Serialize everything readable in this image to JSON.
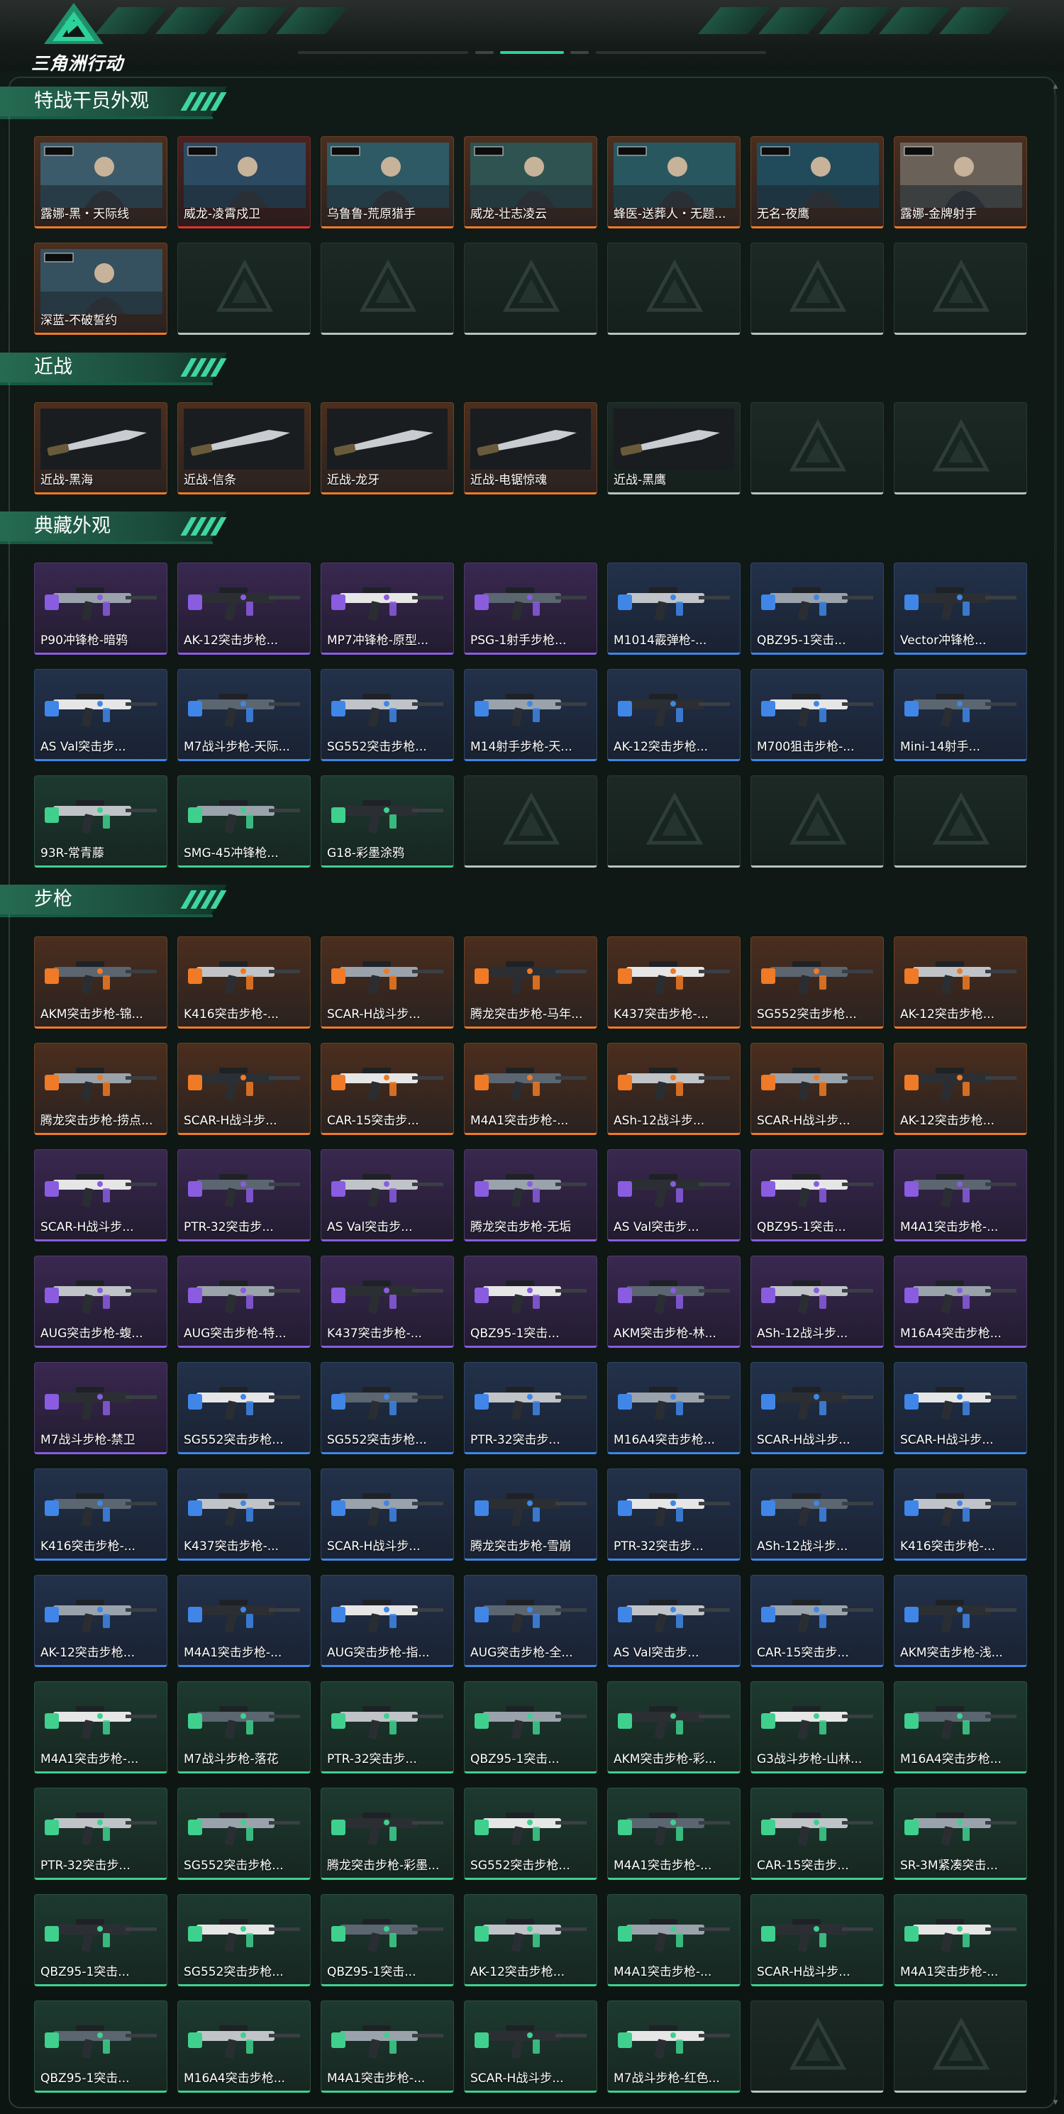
{
  "header": {
    "logo_text": "三角洲行动",
    "logo_icon": "delta-logo-icon",
    "accent": "#2bd29a"
  },
  "colors": {
    "orange": "#f07a25",
    "red": "#e0322c",
    "purple": "#8a5ce0",
    "blue": "#3f86e8",
    "green": "#3fd08e",
    "empty": "#b8c2bf"
  },
  "sections": [
    {
      "title": "特战干员外观",
      "items": [
        {
          "label": "露娜-黑・天际线",
          "rarity": "orange",
          "icon": "operator-portrait"
        },
        {
          "label": "威龙-凌霄戍卫",
          "rarity": "red",
          "icon": "operator-portrait"
        },
        {
          "label": "乌鲁鲁-荒原猎手",
          "rarity": "orange",
          "icon": "operator-portrait"
        },
        {
          "label": "威龙-壮志凌云",
          "rarity": "orange",
          "icon": "operator-portrait"
        },
        {
          "label": "蜂医-送葬人・无题...",
          "rarity": "orange",
          "icon": "operator-portrait"
        },
        {
          "label": "无名-夜鹰",
          "rarity": "orange",
          "icon": "operator-portrait"
        },
        {
          "label": "露娜-金牌射手",
          "rarity": "orange",
          "icon": "operator-portrait"
        },
        {
          "label": "深蓝-不破誓约",
          "rarity": "orange",
          "icon": "operator-portrait"
        },
        {
          "label": "",
          "rarity": "empty",
          "icon": "empty-slot-icon"
        },
        {
          "label": "",
          "rarity": "empty",
          "icon": "empty-slot-icon"
        },
        {
          "label": "",
          "rarity": "empty",
          "icon": "empty-slot-icon"
        },
        {
          "label": "",
          "rarity": "empty",
          "icon": "empty-slot-icon"
        },
        {
          "label": "",
          "rarity": "empty",
          "icon": "empty-slot-icon"
        },
        {
          "label": "",
          "rarity": "empty",
          "icon": "empty-slot-icon"
        }
      ]
    },
    {
      "title": "近战",
      "items": [
        {
          "label": "近战-黑海",
          "rarity": "orange",
          "icon": "melee-weapon"
        },
        {
          "label": "近战-信条",
          "rarity": "orange",
          "icon": "melee-weapon"
        },
        {
          "label": "近战-龙牙",
          "rarity": "orange",
          "icon": "melee-weapon"
        },
        {
          "label": "近战-电锯惊魂",
          "rarity": "orange",
          "icon": "melee-weapon"
        },
        {
          "label": "近战-黑鹰",
          "rarity": "empty",
          "icon": "melee-weapon"
        },
        {
          "label": "",
          "rarity": "empty",
          "icon": "empty-slot-icon"
        },
        {
          "label": "",
          "rarity": "empty",
          "icon": "empty-slot-icon"
        }
      ]
    },
    {
      "title": "典藏外观",
      "items": [
        {
          "label": "P90冲锋枪-暗鸦",
          "rarity": "purple",
          "icon": "gun"
        },
        {
          "label": "AK-12突击步枪...",
          "rarity": "purple",
          "icon": "gun"
        },
        {
          "label": "MP7冲锋枪-原型...",
          "rarity": "purple",
          "icon": "gun"
        },
        {
          "label": "PSG-1射手步枪...",
          "rarity": "purple",
          "icon": "gun"
        },
        {
          "label": "M1014霰弹枪-...",
          "rarity": "blue",
          "icon": "gun"
        },
        {
          "label": "QBZ95-1突击...",
          "rarity": "blue",
          "icon": "gun"
        },
        {
          "label": "Vector冲锋枪...",
          "rarity": "blue",
          "icon": "gun"
        },
        {
          "label": "AS Val突击步...",
          "rarity": "blue",
          "icon": "gun"
        },
        {
          "label": "M7战斗步枪-天际...",
          "rarity": "blue",
          "icon": "gun"
        },
        {
          "label": "SG552突击步枪...",
          "rarity": "blue",
          "icon": "gun"
        },
        {
          "label": "M14射手步枪-天...",
          "rarity": "blue",
          "icon": "gun"
        },
        {
          "label": "AK-12突击步枪...",
          "rarity": "blue",
          "icon": "gun"
        },
        {
          "label": "M700狙击步枪-...",
          "rarity": "blue",
          "icon": "gun"
        },
        {
          "label": "Mini-14射手...",
          "rarity": "blue",
          "icon": "gun"
        },
        {
          "label": "93R-常青藤",
          "rarity": "green",
          "icon": "gun"
        },
        {
          "label": "SMG-45冲锋枪...",
          "rarity": "green",
          "icon": "gun"
        },
        {
          "label": "G18-彩墨涂鸦",
          "rarity": "green",
          "icon": "gun"
        },
        {
          "label": "",
          "rarity": "empty",
          "icon": "empty-slot-icon"
        },
        {
          "label": "",
          "rarity": "empty",
          "icon": "empty-slot-icon"
        },
        {
          "label": "",
          "rarity": "empty",
          "icon": "empty-slot-icon"
        },
        {
          "label": "",
          "rarity": "empty",
          "icon": "empty-slot-icon"
        }
      ]
    },
    {
      "title": "步枪",
      "items": [
        {
          "label": "AKM突击步枪-锦...",
          "rarity": "orange",
          "icon": "gun"
        },
        {
          "label": "K416突击步枪-...",
          "rarity": "orange",
          "icon": "gun"
        },
        {
          "label": "SCAR-H战斗步...",
          "rarity": "orange",
          "icon": "gun"
        },
        {
          "label": "腾龙突击步枪-马年...",
          "rarity": "orange",
          "icon": "gun"
        },
        {
          "label": "K437突击步枪-...",
          "rarity": "orange",
          "icon": "gun"
        },
        {
          "label": "SG552突击步枪...",
          "rarity": "orange",
          "icon": "gun"
        },
        {
          "label": "AK-12突击步枪...",
          "rarity": "orange",
          "icon": "gun"
        },
        {
          "label": "腾龙突击步枪-捞点...",
          "rarity": "orange",
          "icon": "gun"
        },
        {
          "label": "SCAR-H战斗步...",
          "rarity": "orange",
          "icon": "gun"
        },
        {
          "label": "CAR-15突击步...",
          "rarity": "orange",
          "icon": "gun"
        },
        {
          "label": "M4A1突击步枪-...",
          "rarity": "orange",
          "icon": "gun"
        },
        {
          "label": "ASh-12战斗步...",
          "rarity": "orange",
          "icon": "gun"
        },
        {
          "label": "SCAR-H战斗步...",
          "rarity": "orange",
          "icon": "gun"
        },
        {
          "label": "AK-12突击步枪...",
          "rarity": "orange",
          "icon": "gun"
        },
        {
          "label": "SCAR-H战斗步...",
          "rarity": "purple",
          "icon": "gun"
        },
        {
          "label": "PTR-32突击步...",
          "rarity": "purple",
          "icon": "gun"
        },
        {
          "label": "AS Val突击步...",
          "rarity": "purple",
          "icon": "gun"
        },
        {
          "label": "腾龙突击步枪-无垢",
          "rarity": "purple",
          "icon": "gun"
        },
        {
          "label": "AS Val突击步...",
          "rarity": "purple",
          "icon": "gun"
        },
        {
          "label": "QBZ95-1突击...",
          "rarity": "purple",
          "icon": "gun"
        },
        {
          "label": "M4A1突击步枪-...",
          "rarity": "purple",
          "icon": "gun"
        },
        {
          "label": "AUG突击步枪-蝮...",
          "rarity": "purple",
          "icon": "gun"
        },
        {
          "label": "AUG突击步枪-特...",
          "rarity": "purple",
          "icon": "gun"
        },
        {
          "label": "K437突击步枪-...",
          "rarity": "purple",
          "icon": "gun"
        },
        {
          "label": "QBZ95-1突击...",
          "rarity": "purple",
          "icon": "gun"
        },
        {
          "label": "AKM突击步枪-林...",
          "rarity": "purple",
          "icon": "gun"
        },
        {
          "label": "ASh-12战斗步...",
          "rarity": "purple",
          "icon": "gun"
        },
        {
          "label": "M16A4突击步枪...",
          "rarity": "purple",
          "icon": "gun"
        },
        {
          "label": "M7战斗步枪-禁卫",
          "rarity": "purple",
          "icon": "gun"
        },
        {
          "label": "SG552突击步枪...",
          "rarity": "blue",
          "icon": "gun"
        },
        {
          "label": "SG552突击步枪...",
          "rarity": "blue",
          "icon": "gun"
        },
        {
          "label": "PTR-32突击步...",
          "rarity": "blue",
          "icon": "gun"
        },
        {
          "label": "M16A4突击步枪...",
          "rarity": "blue",
          "icon": "gun"
        },
        {
          "label": "SCAR-H战斗步...",
          "rarity": "blue",
          "icon": "gun"
        },
        {
          "label": "SCAR-H战斗步...",
          "rarity": "blue",
          "icon": "gun"
        },
        {
          "label": "K416突击步枪-...",
          "rarity": "blue",
          "icon": "gun"
        },
        {
          "label": "K437突击步枪-...",
          "rarity": "blue",
          "icon": "gun"
        },
        {
          "label": "SCAR-H战斗步...",
          "rarity": "blue",
          "icon": "gun"
        },
        {
          "label": "腾龙突击步枪-雪崩",
          "rarity": "blue",
          "icon": "gun"
        },
        {
          "label": "PTR-32突击步...",
          "rarity": "blue",
          "icon": "gun"
        },
        {
          "label": "ASh-12战斗步...",
          "rarity": "blue",
          "icon": "gun"
        },
        {
          "label": "K416突击步枪-...",
          "rarity": "blue",
          "icon": "gun"
        },
        {
          "label": "AK-12突击步枪...",
          "rarity": "blue",
          "icon": "gun"
        },
        {
          "label": "M4A1突击步枪-...",
          "rarity": "blue",
          "icon": "gun"
        },
        {
          "label": "AUG突击步枪-指...",
          "rarity": "blue",
          "icon": "gun"
        },
        {
          "label": "AUG突击步枪-全...",
          "rarity": "blue",
          "icon": "gun"
        },
        {
          "label": "AS Val突击步...",
          "rarity": "blue",
          "icon": "gun"
        },
        {
          "label": "CAR-15突击步...",
          "rarity": "blue",
          "icon": "gun"
        },
        {
          "label": "AKM突击步枪-浅...",
          "rarity": "blue",
          "icon": "gun"
        },
        {
          "label": "M4A1突击步枪-...",
          "rarity": "green",
          "icon": "gun"
        },
        {
          "label": "M7战斗步枪-落花",
          "rarity": "green",
          "icon": "gun"
        },
        {
          "label": "PTR-32突击步...",
          "rarity": "green",
          "icon": "gun"
        },
        {
          "label": "QBZ95-1突击...",
          "rarity": "green",
          "icon": "gun"
        },
        {
          "label": "AKM突击步枪-彩...",
          "rarity": "green",
          "icon": "gun"
        },
        {
          "label": "G3战斗步枪-山林...",
          "rarity": "green",
          "icon": "gun"
        },
        {
          "label": "M16A4突击步枪...",
          "rarity": "green",
          "icon": "gun"
        },
        {
          "label": "PTR-32突击步...",
          "rarity": "green",
          "icon": "gun"
        },
        {
          "label": "SG552突击步枪...",
          "rarity": "green",
          "icon": "gun"
        },
        {
          "label": "腾龙突击步枪-彩墨...",
          "rarity": "green",
          "icon": "gun"
        },
        {
          "label": "SG552突击步枪...",
          "rarity": "green",
          "icon": "gun"
        },
        {
          "label": "M4A1突击步枪-...",
          "rarity": "green",
          "icon": "gun"
        },
        {
          "label": "CAR-15突击步...",
          "rarity": "green",
          "icon": "gun"
        },
        {
          "label": "SR-3M紧凑突击...",
          "rarity": "green",
          "icon": "gun"
        },
        {
          "label": "QBZ95-1突击...",
          "rarity": "green",
          "icon": "gun"
        },
        {
          "label": "SG552突击步枪...",
          "rarity": "green",
          "icon": "gun"
        },
        {
          "label": "QBZ95-1突击...",
          "rarity": "green",
          "icon": "gun"
        },
        {
          "label": "AK-12突击步枪...",
          "rarity": "green",
          "icon": "gun"
        },
        {
          "label": "M4A1突击步枪-...",
          "rarity": "green",
          "icon": "gun"
        },
        {
          "label": "SCAR-H战斗步...",
          "rarity": "green",
          "icon": "gun"
        },
        {
          "label": "M4A1突击步枪-...",
          "rarity": "green",
          "icon": "gun"
        },
        {
          "label": "QBZ95-1突击...",
          "rarity": "green",
          "icon": "gun"
        },
        {
          "label": "M16A4突击步枪...",
          "rarity": "green",
          "icon": "gun"
        },
        {
          "label": "M4A1突击步枪-...",
          "rarity": "green",
          "icon": "gun"
        },
        {
          "label": "SCAR-H战斗步...",
          "rarity": "green",
          "icon": "gun"
        },
        {
          "label": "M7战斗步枪-红色...",
          "rarity": "green",
          "icon": "gun"
        },
        {
          "label": "",
          "rarity": "empty",
          "icon": "empty-slot-icon"
        },
        {
          "label": "",
          "rarity": "empty",
          "icon": "empty-slot-icon"
        }
      ]
    }
  ]
}
